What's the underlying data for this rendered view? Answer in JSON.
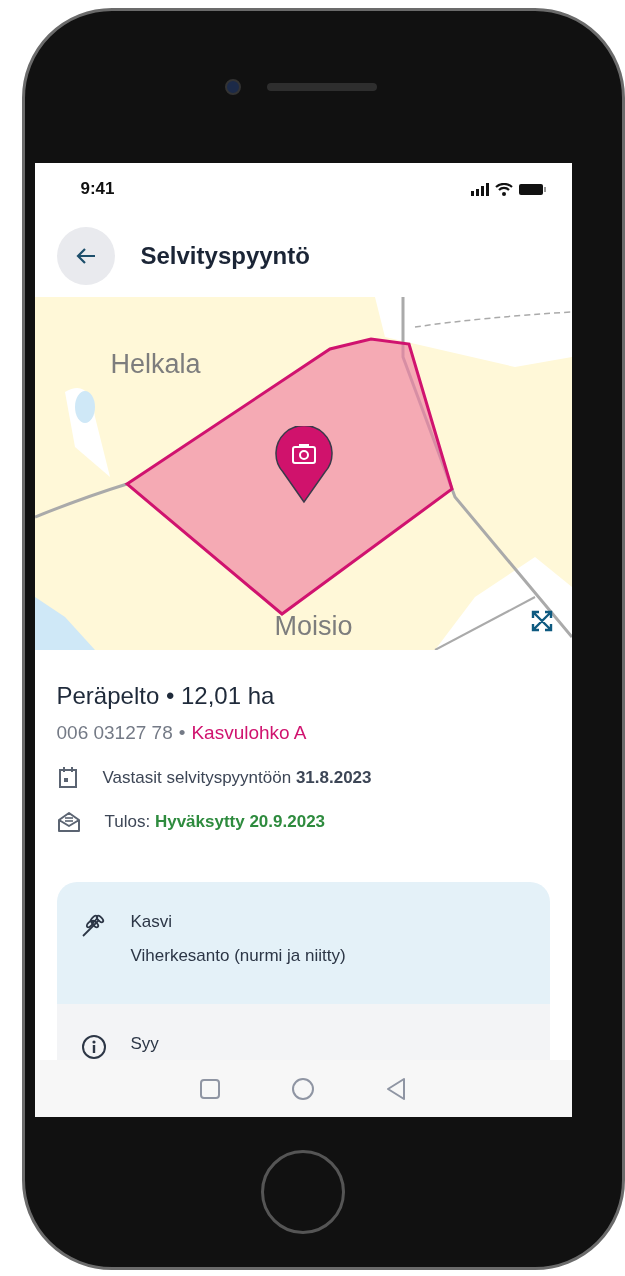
{
  "status_bar": {
    "time": "9:41"
  },
  "header": {
    "title": "Selvityspyyntö"
  },
  "map": {
    "place_labels": [
      "Helkala",
      "Moisio"
    ]
  },
  "parcel": {
    "title": "Peräpelto • 12,01 ha",
    "id": "006 03127 78",
    "separator": "•",
    "block": "Kasvulohko A"
  },
  "events": [
    {
      "kind": "date",
      "text": "Vastasit selvityspyyntöön **31.8.2023**"
    },
    {
      "kind": "result",
      "text": "Tulos:",
      "value": "Hyväksytty 20.9.2023"
    }
  ],
  "info_cards": [
    {
      "kind": "plant",
      "label": "Kasvi",
      "value": "Viherkesanto (nurmi ja niitty)",
      "highlighted": true
    },
    {
      "kind": "info",
      "label": "Syy",
      "highlighted": false
    }
  ]
}
